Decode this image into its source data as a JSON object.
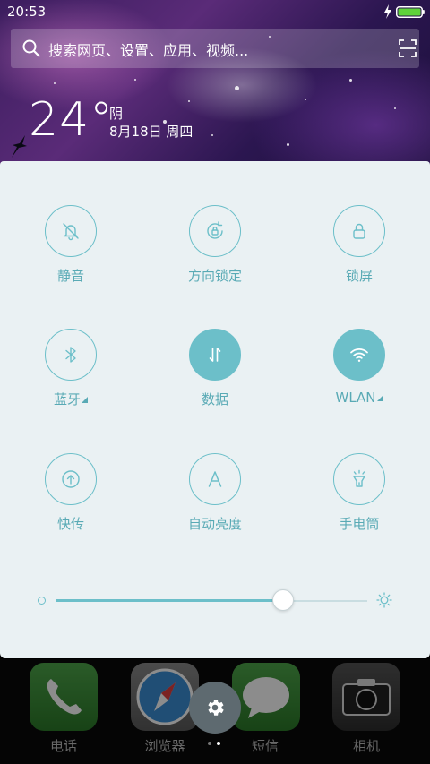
{
  "status_bar": {
    "time": "20:53",
    "icons": [
      "charging-bolt-icon",
      "battery-icon"
    ],
    "battery_color": "#5fd23a"
  },
  "search": {
    "placeholder": "搜索网页、设置、应用、视频...",
    "icons": [
      "search-icon",
      "scan-icon"
    ]
  },
  "weather": {
    "temperature": "24°",
    "condition": "阴",
    "date": "8月18日 周四"
  },
  "control_center": {
    "accent_color": "#6cbfc9",
    "toggles": [
      {
        "label": "静音",
        "icon": "bell-off-icon",
        "active": false,
        "has_menu": false
      },
      {
        "label": "方向锁定",
        "icon": "rotation-lock-icon",
        "active": false,
        "has_menu": false
      },
      {
        "label": "锁屏",
        "icon": "lock-icon",
        "active": false,
        "has_menu": false
      },
      {
        "label": "蓝牙",
        "icon": "bluetooth-icon",
        "active": false,
        "has_menu": true
      },
      {
        "label": "数据",
        "icon": "data-arrows-icon",
        "active": true,
        "has_menu": false
      },
      {
        "label": "WLAN",
        "icon": "wifi-icon",
        "active": true,
        "has_menu": true
      },
      {
        "label": "快传",
        "icon": "upload-icon",
        "active": false,
        "has_menu": false
      },
      {
        "label": "自动亮度",
        "icon": "letter-a-icon",
        "active": false,
        "has_menu": false
      },
      {
        "label": "手电筒",
        "icon": "flashlight-icon",
        "active": false,
        "has_menu": false
      }
    ],
    "brightness": {
      "level": 0.73,
      "icons": [
        "brightness-low-icon",
        "brightness-high-icon"
      ]
    }
  },
  "dock": {
    "apps": [
      {
        "label": "电话",
        "icon": "phone-icon"
      },
      {
        "label": "浏览器",
        "icon": "browser-compass-icon"
      },
      {
        "label": "短信",
        "icon": "message-bubble-icon"
      },
      {
        "label": "相机",
        "icon": "camera-icon"
      }
    ],
    "settings_icon": "gear-icon",
    "pages": {
      "count": 2,
      "current": 2
    }
  }
}
